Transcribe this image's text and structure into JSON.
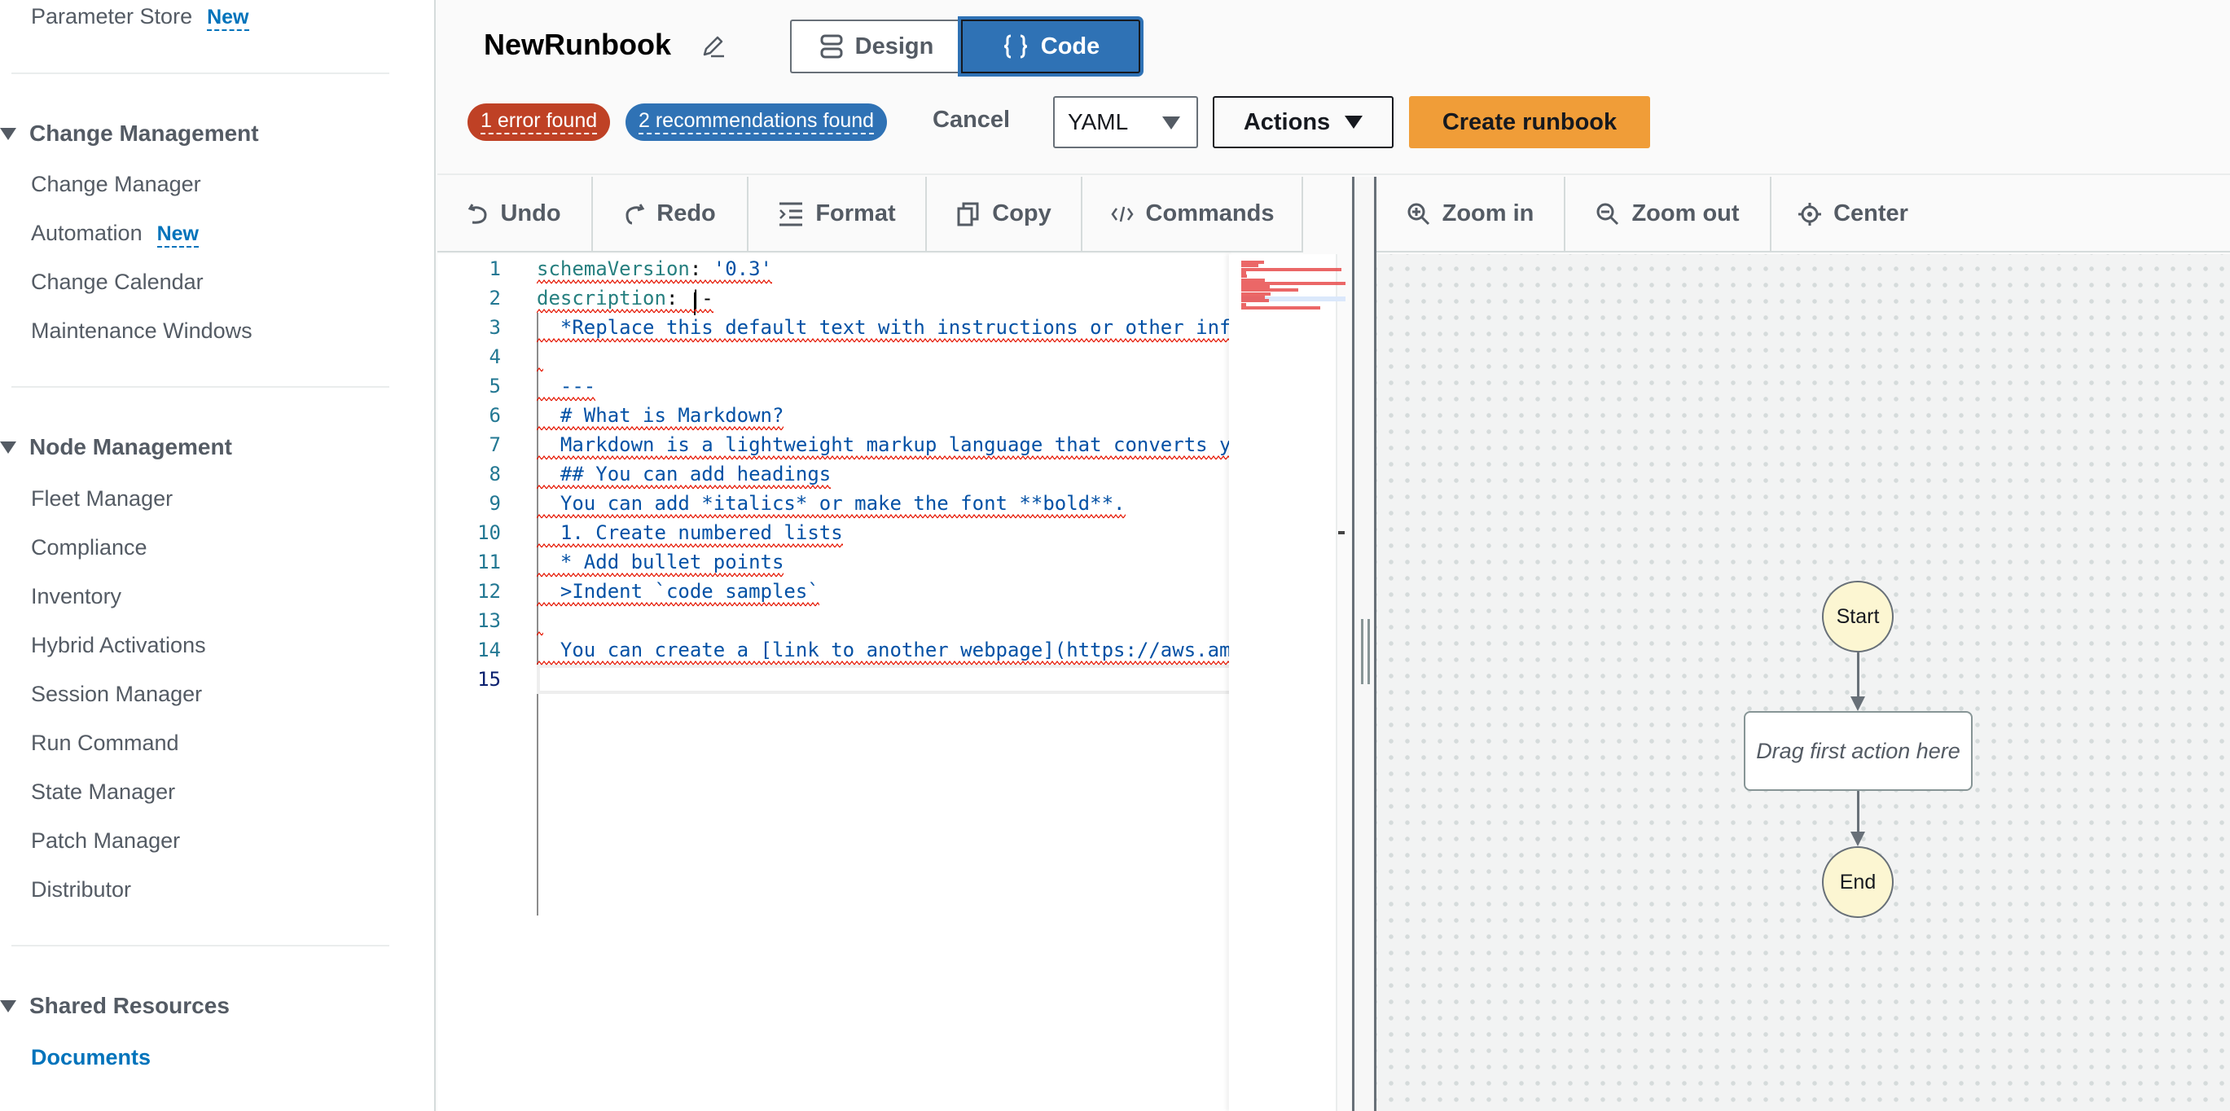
{
  "sidebar": {
    "top_item": {
      "label": "Parameter Store",
      "badge": "New"
    },
    "sections": [
      {
        "title": "Change Management",
        "items": [
          {
            "label": "Change Manager"
          },
          {
            "label": "Automation",
            "badge": "New"
          },
          {
            "label": "Change Calendar"
          },
          {
            "label": "Maintenance Windows"
          }
        ]
      },
      {
        "title": "Node Management",
        "items": [
          {
            "label": "Fleet Manager"
          },
          {
            "label": "Compliance"
          },
          {
            "label": "Inventory"
          },
          {
            "label": "Hybrid Activations"
          },
          {
            "label": "Session Manager"
          },
          {
            "label": "Run Command"
          },
          {
            "label": "State Manager"
          },
          {
            "label": "Patch Manager"
          },
          {
            "label": "Distributor"
          }
        ]
      },
      {
        "title": "Shared Resources",
        "items": [
          {
            "label": "Documents",
            "active": true
          }
        ]
      }
    ]
  },
  "header": {
    "title": "NewRunbook",
    "edit_icon": "pencil-icon",
    "view_modes": [
      {
        "label": "Design",
        "icon": "design-icon",
        "selected": false
      },
      {
        "label": "Code",
        "icon": "braces-icon",
        "selected": true
      }
    ],
    "error_badge": "1 error found",
    "recommendations_badge": "2 recommendations found",
    "cancel_label": "Cancel",
    "format_select": {
      "value": "YAML"
    },
    "actions_label": "Actions",
    "create_label": "Create runbook",
    "colors": {
      "error": "#bf4125",
      "info": "#2f72b5",
      "primary": "#f09d38"
    }
  },
  "editor_toolbar": [
    {
      "label": "Undo",
      "icon": "undo-icon"
    },
    {
      "label": "Redo",
      "icon": "redo-icon"
    },
    {
      "label": "Format",
      "icon": "format-icon"
    },
    {
      "label": "Copy",
      "icon": "copy-icon"
    },
    {
      "label": "Commands",
      "icon": "code-icon"
    }
  ],
  "canvas_toolbar": [
    {
      "label": "Zoom in",
      "icon": "zoom-in-icon"
    },
    {
      "label": "Zoom out",
      "icon": "zoom-out-icon"
    },
    {
      "label": "Center",
      "icon": "center-icon"
    }
  ],
  "editor": {
    "current_line": 15,
    "lines": [
      {
        "n": "1",
        "key": "schemaVersion",
        "sep": ": ",
        "value": "'0.3'"
      },
      {
        "n": "2",
        "key": "description",
        "sep": ": ",
        "value": "|-"
      },
      {
        "n": "3",
        "text": "  *Replace this default text with instructions or other information about your runbook.*"
      },
      {
        "n": "4",
        "text": ""
      },
      {
        "n": "5",
        "text": "  ---"
      },
      {
        "n": "6",
        "text": "  # What is Markdown?"
      },
      {
        "n": "7",
        "text": "  Markdown is a lightweight markup language that converts your content with plain text formatting to structurally valid rich text."
      },
      {
        "n": "8",
        "text": "  ## You can add headings"
      },
      {
        "n": "9",
        "text": "  You can add *italics* or make the font **bold**."
      },
      {
        "n": "10",
        "text": "  1. Create numbered lists"
      },
      {
        "n": "11",
        "text": "  * Add bullet points"
      },
      {
        "n": "12",
        "text": "  >Indent `code samples`"
      },
      {
        "n": "13",
        "text": ""
      },
      {
        "n": "14",
        "text": "  You can create a [link to another webpage](https://aws.amazon.com)."
      },
      {
        "n": "15",
        "text": ""
      }
    ]
  },
  "canvas": {
    "start_label": "Start",
    "placeholder_label": "Drag first action here",
    "end_label": "End"
  }
}
